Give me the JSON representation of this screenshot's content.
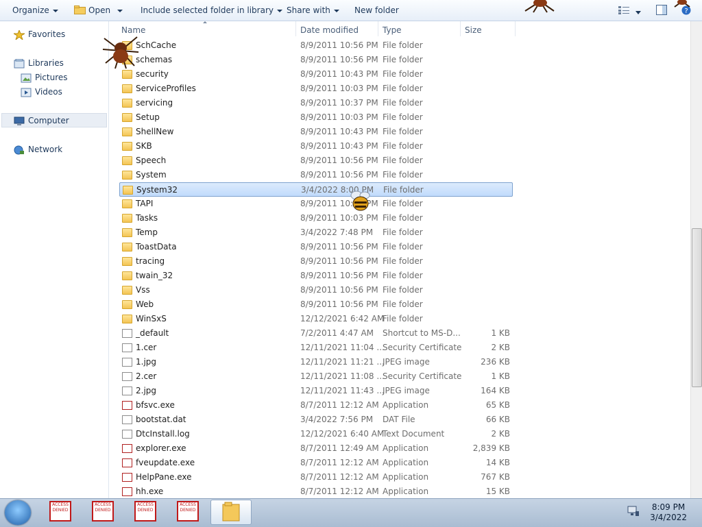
{
  "toolbar": {
    "organize": "Organize",
    "open": "Open",
    "include_library": "Include selected folder in library",
    "share_with": "Share with",
    "new_folder": "New folder"
  },
  "nav": {
    "favorites": "Favorites",
    "libraries": "Libraries",
    "pictures": "Pictures",
    "videos": "Videos",
    "computer": "Computer",
    "network": "Network"
  },
  "columns": {
    "name": "Name",
    "date_modified": "Date modified",
    "type": "Type",
    "size": "Size"
  },
  "rows": [
    {
      "name": "SchCache",
      "date": "8/9/2011 10:56 PM",
      "type": "File folder",
      "size": "",
      "icon": "folder"
    },
    {
      "name": "schemas",
      "date": "8/9/2011 10:56 PM",
      "type": "File folder",
      "size": "",
      "icon": "folder"
    },
    {
      "name": "security",
      "date": "8/9/2011 10:43 PM",
      "type": "File folder",
      "size": "",
      "icon": "folder"
    },
    {
      "name": "ServiceProfiles",
      "date": "8/9/2011 10:03 PM",
      "type": "File folder",
      "size": "",
      "icon": "folder"
    },
    {
      "name": "servicing",
      "date": "8/9/2011 10:37 PM",
      "type": "File folder",
      "size": "",
      "icon": "folder"
    },
    {
      "name": "Setup",
      "date": "8/9/2011 10:03 PM",
      "type": "File folder",
      "size": "",
      "icon": "folder"
    },
    {
      "name": "ShellNew",
      "date": "8/9/2011 10:43 PM",
      "type": "File folder",
      "size": "",
      "icon": "folder"
    },
    {
      "name": "SKB",
      "date": "8/9/2011 10:43 PM",
      "type": "File folder",
      "size": "",
      "icon": "folder"
    },
    {
      "name": "Speech",
      "date": "8/9/2011 10:56 PM",
      "type": "File folder",
      "size": "",
      "icon": "folder"
    },
    {
      "name": "System",
      "date": "8/9/2011 10:56 PM",
      "type": "File folder",
      "size": "",
      "icon": "folder"
    },
    {
      "name": "System32",
      "date": "3/4/2022 8:00 PM",
      "type": "File folder",
      "size": "",
      "icon": "folder",
      "selected": true
    },
    {
      "name": "TAPI",
      "date": "8/9/2011 10:56 PM",
      "type": "File folder",
      "size": "",
      "icon": "folder"
    },
    {
      "name": "Tasks",
      "date": "8/9/2011 10:03 PM",
      "type": "File folder",
      "size": "",
      "icon": "folder"
    },
    {
      "name": "Temp",
      "date": "3/4/2022 7:48 PM",
      "type": "File folder",
      "size": "",
      "icon": "folder"
    },
    {
      "name": "ToastData",
      "date": "8/9/2011 10:56 PM",
      "type": "File folder",
      "size": "",
      "icon": "folder"
    },
    {
      "name": "tracing",
      "date": "8/9/2011 10:56 PM",
      "type": "File folder",
      "size": "",
      "icon": "folder"
    },
    {
      "name": "twain_32",
      "date": "8/9/2011 10:56 PM",
      "type": "File folder",
      "size": "",
      "icon": "folder"
    },
    {
      "name": "Vss",
      "date": "8/9/2011 10:56 PM",
      "type": "File folder",
      "size": "",
      "icon": "folder"
    },
    {
      "name": "Web",
      "date": "8/9/2011 10:56 PM",
      "type": "File folder",
      "size": "",
      "icon": "folder"
    },
    {
      "name": "WinSxS",
      "date": "12/12/2021 6:42 AM",
      "type": "File folder",
      "size": "",
      "icon": "folder"
    },
    {
      "name": "_default",
      "date": "7/2/2011 4:47 AM",
      "type": "Shortcut to MS-D...",
      "size": "1 KB",
      "icon": "shortcut"
    },
    {
      "name": "1.cer",
      "date": "12/11/2021 11:04 ...",
      "type": "Security Certificate",
      "size": "2 KB",
      "icon": "cert"
    },
    {
      "name": "1.jpg",
      "date": "12/11/2021 11:21 ...",
      "type": "JPEG image",
      "size": "236 KB",
      "icon": "image"
    },
    {
      "name": "2.cer",
      "date": "12/11/2021 11:08 ...",
      "type": "Security Certificate",
      "size": "1 KB",
      "icon": "cert"
    },
    {
      "name": "2.jpg",
      "date": "12/11/2021 11:43 ...",
      "type": "JPEG image",
      "size": "164 KB",
      "icon": "image"
    },
    {
      "name": "bfsvc.exe",
      "date": "8/7/2011 12:12 AM",
      "type": "Application",
      "size": "65 KB",
      "icon": "exe"
    },
    {
      "name": "bootstat.dat",
      "date": "3/4/2022 7:56 PM",
      "type": "DAT File",
      "size": "66 KB",
      "icon": "file"
    },
    {
      "name": "DtcInstall.log",
      "date": "12/12/2021 6:40 AM",
      "type": "Text Document",
      "size": "2 KB",
      "icon": "text"
    },
    {
      "name": "explorer.exe",
      "date": "8/7/2011 12:49 AM",
      "type": "Application",
      "size": "2,839 KB",
      "icon": "exe"
    },
    {
      "name": "fveupdate.exe",
      "date": "8/7/2011 12:12 AM",
      "type": "Application",
      "size": "14 KB",
      "icon": "exe"
    },
    {
      "name": "HelpPane.exe",
      "date": "8/7/2011 12:12 AM",
      "type": "Application",
      "size": "767 KB",
      "icon": "exe"
    },
    {
      "name": "hh.exe",
      "date": "8/7/2011 12:12 AM",
      "type": "Application",
      "size": "15 KB",
      "icon": "exe"
    }
  ],
  "taskbar": {
    "time": "8:09 PM",
    "date": "3/4/2022",
    "access_denied_label": "ACCESS DENIED"
  }
}
